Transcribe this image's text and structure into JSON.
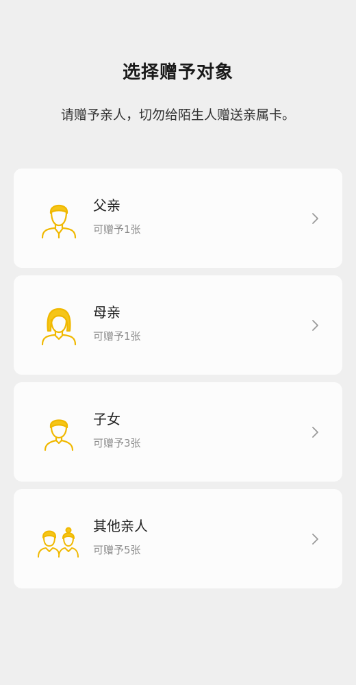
{
  "header": {
    "title": "选择赠予对象",
    "subtitle": "请赠予亲人，切勿给陌生人赠送亲属卡。"
  },
  "recipients": [
    {
      "label": "父亲",
      "count_text": "可赠予1张",
      "icon": "father-icon"
    },
    {
      "label": "母亲",
      "count_text": "可赠予1张",
      "icon": "mother-icon"
    },
    {
      "label": "子女",
      "count_text": "可赠予3张",
      "icon": "child-icon"
    },
    {
      "label": "其他亲人",
      "count_text": "可赠予5张",
      "icon": "other-relatives-icon"
    }
  ],
  "colors": {
    "accent": "#f5c518",
    "icon_stroke": "#f0b800",
    "background": "#efefef",
    "card": "#fcfcfc"
  }
}
